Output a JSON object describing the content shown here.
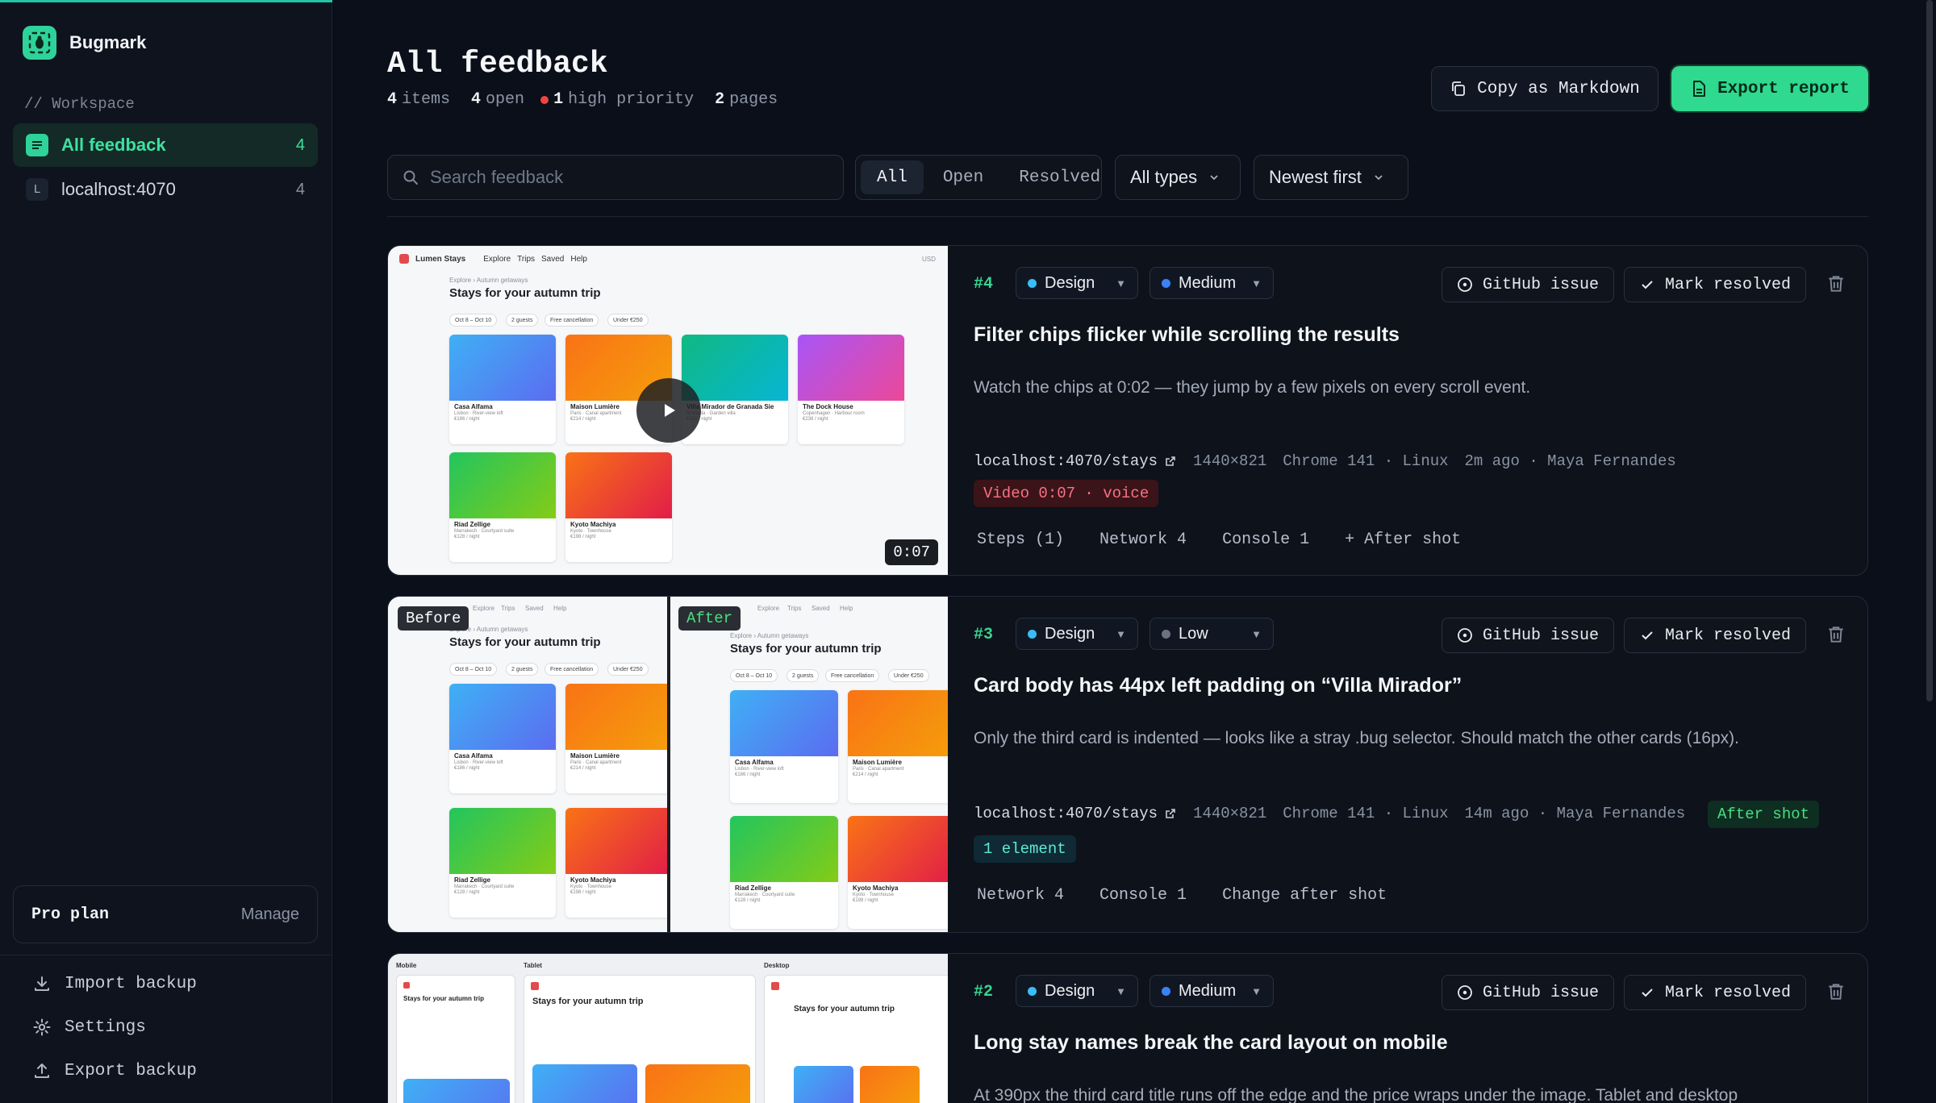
{
  "app": {
    "name": "Bugmark"
  },
  "sidebar": {
    "section_label": "// Workspace",
    "items": [
      {
        "label": "All feedback",
        "count": "4",
        "icon": "list-icon"
      },
      {
        "label": "localhost:4070",
        "count": "4",
        "letter": "L"
      }
    ],
    "plan": {
      "label": "Pro plan",
      "manage": "Manage"
    },
    "links": [
      {
        "label": "Import backup",
        "icon": "download-icon"
      },
      {
        "label": "Settings",
        "icon": "gear-icon"
      },
      {
        "label": "Export backup",
        "icon": "upload-icon"
      }
    ]
  },
  "header": {
    "title": "All feedback",
    "stats": {
      "items_num": "4",
      "items_label": "items",
      "open_num": "4",
      "open_label": "open",
      "priority_num": "1",
      "priority_label": "high priority",
      "pages_num": "2",
      "pages_label": "pages"
    },
    "copy_label": "Copy as Markdown",
    "export_label": "Export report"
  },
  "filters": {
    "search_placeholder": "Search feedback",
    "segments": [
      "All",
      "Open",
      "Resolved"
    ],
    "active_segment": "All",
    "type_select": "All types",
    "sort_select": "Newest first"
  },
  "colors": {
    "accent": "#2fd98f",
    "high": "#ef4444",
    "medium": "#3b82f6",
    "low": "#6b7280",
    "design": "#38bdf8"
  },
  "cards": [
    {
      "id": "#4",
      "category": "Design",
      "priority": "Medium",
      "github_label": "GitHub issue",
      "resolve_label": "Mark resolved",
      "title": "Filter chips flicker while scrolling the results",
      "description": "Watch the chips at 0:02 — they jump by a few pixels on every scroll event.",
      "url": "localhost:4070/stays",
      "viewport": "1440×821",
      "browser": "Chrome 141",
      "os": "Linux",
      "time": "2m ago",
      "author": "Maya Fernandes",
      "tags": [
        "Video 0:07 · voice"
      ],
      "tabs": [
        "Steps (1)",
        "Network 4",
        "Console 1",
        "+ After shot"
      ],
      "duration": "0:07"
    },
    {
      "id": "#3",
      "category": "Design",
      "priority": "Low",
      "github_label": "GitHub issue",
      "resolve_label": "Mark resolved",
      "title": "Card body has 44px left padding on “Villa Mirador”",
      "description": "Only the third card is indented — looks like a stray .bug selector. Should match the other cards (16px).",
      "url": "localhost:4070/stays",
      "viewport": "1440×821",
      "browser": "Chrome 141",
      "os": "Linux",
      "time": "14m ago",
      "author": "Maya Fernandes",
      "tags": [
        "After shot",
        "1 element"
      ],
      "tabs": [
        "Network 4",
        "Console 1",
        "Change after shot"
      ],
      "before_label": "Before",
      "after_label": "After"
    },
    {
      "id": "#2",
      "category": "Design",
      "priority": "Medium",
      "github_label": "GitHub issue",
      "resolve_label": "Mark resolved",
      "title": "Long stay names break the card layout on mobile",
      "description": "At 390px the third card title runs off the edge and the price wraps under the image. Tablet and desktop",
      "viewports": [
        "Mobile",
        "Tablet",
        "Desktop"
      ]
    }
  ],
  "mock": {
    "brand": "Lumen Stays",
    "nav": [
      "Explore",
      "Trips",
      "Saved",
      "Help"
    ],
    "currency": "USD",
    "crumb": "Explore › Autumn getaways",
    "heading": "Stays for your autumn trip",
    "chips": [
      "Oct 8 – Oct 10",
      "2 guests",
      "Free cancellation",
      "Under €250"
    ],
    "listings": [
      {
        "name": "Casa Alfama",
        "place": "Lisbon · River-view loft",
        "price": "€186 / night"
      },
      {
        "name": "Maison Lumière",
        "place": "Paris · Canal apartment",
        "price": "€214 / night"
      },
      {
        "name": "Villa Mirador de Granada Sie",
        "place": "Granada · Garden villa",
        "price": "€162 / night"
      },
      {
        "name": "The Dock House",
        "place": "Copenhagen · Harbour room",
        "price": "€238 / night"
      },
      {
        "name": "Riad Zellige",
        "place": "Marrakech · Courtyard suite",
        "price": "€128 / night"
      },
      {
        "name": "Kyoto Machiya",
        "place": "Kyoto · Townhouse",
        "price": "€198 / night"
      }
    ]
  }
}
